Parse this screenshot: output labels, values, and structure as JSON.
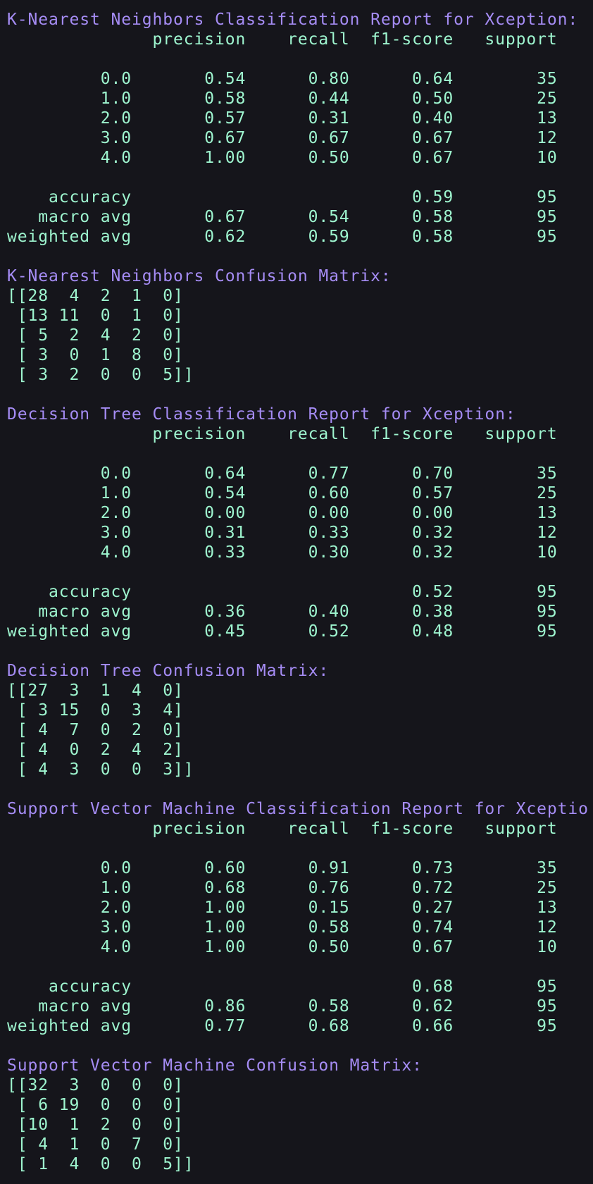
{
  "theme": {
    "background": "#15151b",
    "heading_color": "#a58cf4",
    "body_color": "#9ef5cf"
  },
  "lines": [
    {
      "type": "heading",
      "text": "K-Nearest Neighbors Classification Report for Xception:"
    },
    {
      "type": "body",
      "text": "              precision    recall  f1-score   support"
    },
    {
      "type": "blank",
      "text": ""
    },
    {
      "type": "body",
      "text": "         0.0       0.54      0.80      0.64        35"
    },
    {
      "type": "body",
      "text": "         1.0       0.58      0.44      0.50        25"
    },
    {
      "type": "body",
      "text": "         2.0       0.57      0.31      0.40        13"
    },
    {
      "type": "body",
      "text": "         3.0       0.67      0.67      0.67        12"
    },
    {
      "type": "body",
      "text": "         4.0       1.00      0.50      0.67        10"
    },
    {
      "type": "blank",
      "text": ""
    },
    {
      "type": "body",
      "text": "    accuracy                           0.59        95"
    },
    {
      "type": "body",
      "text": "   macro avg       0.67      0.54      0.58        95"
    },
    {
      "type": "body",
      "text": "weighted avg       0.62      0.59      0.58        95"
    },
    {
      "type": "blank",
      "text": ""
    },
    {
      "type": "heading",
      "text": "K-Nearest Neighbors Confusion Matrix:"
    },
    {
      "type": "body",
      "text": "[[28  4  2  1  0]"
    },
    {
      "type": "body",
      "text": " [13 11  0  1  0]"
    },
    {
      "type": "body",
      "text": " [ 5  2  4  2  0]"
    },
    {
      "type": "body",
      "text": " [ 3  0  1  8  0]"
    },
    {
      "type": "body",
      "text": " [ 3  2  0  0  5]]"
    },
    {
      "type": "blank",
      "text": ""
    },
    {
      "type": "heading",
      "text": "Decision Tree Classification Report for Xception:"
    },
    {
      "type": "body",
      "text": "              precision    recall  f1-score   support"
    },
    {
      "type": "blank",
      "text": ""
    },
    {
      "type": "body",
      "text": "         0.0       0.64      0.77      0.70        35"
    },
    {
      "type": "body",
      "text": "         1.0       0.54      0.60      0.57        25"
    },
    {
      "type": "body",
      "text": "         2.0       0.00      0.00      0.00        13"
    },
    {
      "type": "body",
      "text": "         3.0       0.31      0.33      0.32        12"
    },
    {
      "type": "body",
      "text": "         4.0       0.33      0.30      0.32        10"
    },
    {
      "type": "blank",
      "text": ""
    },
    {
      "type": "body",
      "text": "    accuracy                           0.52        95"
    },
    {
      "type": "body",
      "text": "   macro avg       0.36      0.40      0.38        95"
    },
    {
      "type": "body",
      "text": "weighted avg       0.45      0.52      0.48        95"
    },
    {
      "type": "blank",
      "text": ""
    },
    {
      "type": "heading",
      "text": "Decision Tree Confusion Matrix:"
    },
    {
      "type": "body",
      "text": "[[27  3  1  4  0]"
    },
    {
      "type": "body",
      "text": " [ 3 15  0  3  4]"
    },
    {
      "type": "body",
      "text": " [ 4  7  0  2  0]"
    },
    {
      "type": "body",
      "text": " [ 4  0  2  4  2]"
    },
    {
      "type": "body",
      "text": " [ 4  3  0  0  3]]"
    },
    {
      "type": "blank",
      "text": ""
    },
    {
      "type": "heading",
      "text": "Support Vector Machine Classification Report for Xception:"
    },
    {
      "type": "body",
      "text": "              precision    recall  f1-score   support"
    },
    {
      "type": "blank",
      "text": ""
    },
    {
      "type": "body",
      "text": "         0.0       0.60      0.91      0.73        35"
    },
    {
      "type": "body",
      "text": "         1.0       0.68      0.76      0.72        25"
    },
    {
      "type": "body",
      "text": "         2.0       1.00      0.15      0.27        13"
    },
    {
      "type": "body",
      "text": "         3.0       1.00      0.58      0.74        12"
    },
    {
      "type": "body",
      "text": "         4.0       1.00      0.50      0.67        10"
    },
    {
      "type": "blank",
      "text": ""
    },
    {
      "type": "body",
      "text": "    accuracy                           0.68        95"
    },
    {
      "type": "body",
      "text": "   macro avg       0.86      0.58      0.62        95"
    },
    {
      "type": "body",
      "text": "weighted avg       0.77      0.68      0.66        95"
    },
    {
      "type": "blank",
      "text": ""
    },
    {
      "type": "heading",
      "text": "Support Vector Machine Confusion Matrix:"
    },
    {
      "type": "body",
      "text": "[[32  3  0  0  0]"
    },
    {
      "type": "body",
      "text": " [ 6 19  0  0  0]"
    },
    {
      "type": "body",
      "text": " [10  1  2  0  0]"
    },
    {
      "type": "body",
      "text": " [ 4  1  0  7  0]"
    },
    {
      "type": "body",
      "text": " [ 1  4  0  0  5]]"
    }
  ]
}
